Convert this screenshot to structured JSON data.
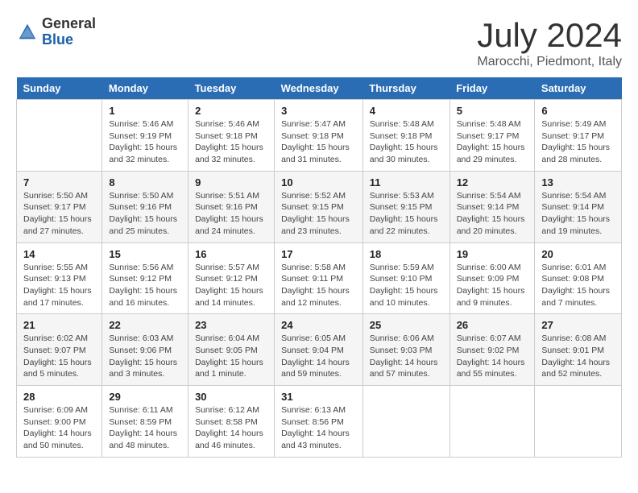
{
  "header": {
    "logo_general": "General",
    "logo_blue": "Blue",
    "title": "July 2024",
    "location": "Marocchi, Piedmont, Italy"
  },
  "columns": [
    "Sunday",
    "Monday",
    "Tuesday",
    "Wednesday",
    "Thursday",
    "Friday",
    "Saturday"
  ],
  "weeks": [
    [
      {
        "day": "",
        "info": ""
      },
      {
        "day": "1",
        "info": "Sunrise: 5:46 AM\nSunset: 9:19 PM\nDaylight: 15 hours\nand 32 minutes."
      },
      {
        "day": "2",
        "info": "Sunrise: 5:46 AM\nSunset: 9:18 PM\nDaylight: 15 hours\nand 32 minutes."
      },
      {
        "day": "3",
        "info": "Sunrise: 5:47 AM\nSunset: 9:18 PM\nDaylight: 15 hours\nand 31 minutes."
      },
      {
        "day": "4",
        "info": "Sunrise: 5:48 AM\nSunset: 9:18 PM\nDaylight: 15 hours\nand 30 minutes."
      },
      {
        "day": "5",
        "info": "Sunrise: 5:48 AM\nSunset: 9:17 PM\nDaylight: 15 hours\nand 29 minutes."
      },
      {
        "day": "6",
        "info": "Sunrise: 5:49 AM\nSunset: 9:17 PM\nDaylight: 15 hours\nand 28 minutes."
      }
    ],
    [
      {
        "day": "7",
        "info": "Sunrise: 5:50 AM\nSunset: 9:17 PM\nDaylight: 15 hours\nand 27 minutes."
      },
      {
        "day": "8",
        "info": "Sunrise: 5:50 AM\nSunset: 9:16 PM\nDaylight: 15 hours\nand 25 minutes."
      },
      {
        "day": "9",
        "info": "Sunrise: 5:51 AM\nSunset: 9:16 PM\nDaylight: 15 hours\nand 24 minutes."
      },
      {
        "day": "10",
        "info": "Sunrise: 5:52 AM\nSunset: 9:15 PM\nDaylight: 15 hours\nand 23 minutes."
      },
      {
        "day": "11",
        "info": "Sunrise: 5:53 AM\nSunset: 9:15 PM\nDaylight: 15 hours\nand 22 minutes."
      },
      {
        "day": "12",
        "info": "Sunrise: 5:54 AM\nSunset: 9:14 PM\nDaylight: 15 hours\nand 20 minutes."
      },
      {
        "day": "13",
        "info": "Sunrise: 5:54 AM\nSunset: 9:14 PM\nDaylight: 15 hours\nand 19 minutes."
      }
    ],
    [
      {
        "day": "14",
        "info": "Sunrise: 5:55 AM\nSunset: 9:13 PM\nDaylight: 15 hours\nand 17 minutes."
      },
      {
        "day": "15",
        "info": "Sunrise: 5:56 AM\nSunset: 9:12 PM\nDaylight: 15 hours\nand 16 minutes."
      },
      {
        "day": "16",
        "info": "Sunrise: 5:57 AM\nSunset: 9:12 PM\nDaylight: 15 hours\nand 14 minutes."
      },
      {
        "day": "17",
        "info": "Sunrise: 5:58 AM\nSunset: 9:11 PM\nDaylight: 15 hours\nand 12 minutes."
      },
      {
        "day": "18",
        "info": "Sunrise: 5:59 AM\nSunset: 9:10 PM\nDaylight: 15 hours\nand 10 minutes."
      },
      {
        "day": "19",
        "info": "Sunrise: 6:00 AM\nSunset: 9:09 PM\nDaylight: 15 hours\nand 9 minutes."
      },
      {
        "day": "20",
        "info": "Sunrise: 6:01 AM\nSunset: 9:08 PM\nDaylight: 15 hours\nand 7 minutes."
      }
    ],
    [
      {
        "day": "21",
        "info": "Sunrise: 6:02 AM\nSunset: 9:07 PM\nDaylight: 15 hours\nand 5 minutes."
      },
      {
        "day": "22",
        "info": "Sunrise: 6:03 AM\nSunset: 9:06 PM\nDaylight: 15 hours\nand 3 minutes."
      },
      {
        "day": "23",
        "info": "Sunrise: 6:04 AM\nSunset: 9:05 PM\nDaylight: 15 hours\nand 1 minute."
      },
      {
        "day": "24",
        "info": "Sunrise: 6:05 AM\nSunset: 9:04 PM\nDaylight: 14 hours\nand 59 minutes."
      },
      {
        "day": "25",
        "info": "Sunrise: 6:06 AM\nSunset: 9:03 PM\nDaylight: 14 hours\nand 57 minutes."
      },
      {
        "day": "26",
        "info": "Sunrise: 6:07 AM\nSunset: 9:02 PM\nDaylight: 14 hours\nand 55 minutes."
      },
      {
        "day": "27",
        "info": "Sunrise: 6:08 AM\nSunset: 9:01 PM\nDaylight: 14 hours\nand 52 minutes."
      }
    ],
    [
      {
        "day": "28",
        "info": "Sunrise: 6:09 AM\nSunset: 9:00 PM\nDaylight: 14 hours\nand 50 minutes."
      },
      {
        "day": "29",
        "info": "Sunrise: 6:11 AM\nSunset: 8:59 PM\nDaylight: 14 hours\nand 48 minutes."
      },
      {
        "day": "30",
        "info": "Sunrise: 6:12 AM\nSunset: 8:58 PM\nDaylight: 14 hours\nand 46 minutes."
      },
      {
        "day": "31",
        "info": "Sunrise: 6:13 AM\nSunset: 8:56 PM\nDaylight: 14 hours\nand 43 minutes."
      },
      {
        "day": "",
        "info": ""
      },
      {
        "day": "",
        "info": ""
      },
      {
        "day": "",
        "info": ""
      }
    ]
  ]
}
